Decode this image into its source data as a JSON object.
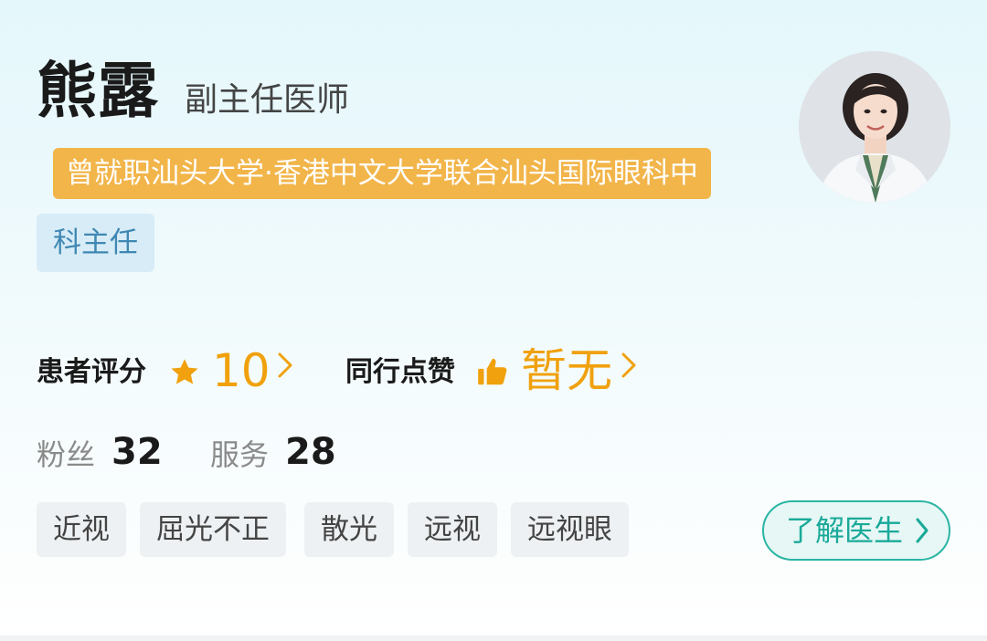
{
  "doctor": {
    "name": "熊露",
    "title": "副主任医师",
    "affiliation_tag": "曾就职汕头大学·香港中文大学联合汕头国际眼科中",
    "department_tag": "科主任",
    "avatar_icon": "doctor-photo"
  },
  "ratings": {
    "patient_label": "患者评分",
    "patient_icon": "star-icon",
    "patient_value": "10",
    "peer_label": "同行点赞",
    "peer_icon": "thumbs-up-icon",
    "peer_value": "暂无",
    "accent_color": "#f0a10d"
  },
  "counts": {
    "fans_label": "粉丝",
    "fans_value": "32",
    "service_label": "服务",
    "service_value": "28"
  },
  "tags": [
    "近视",
    "屈光不正",
    "散光",
    "远视",
    "远视眼"
  ],
  "action": {
    "learn_label": "了解医生",
    "learn_icon": "chevron-right-icon",
    "color": "#1aa999"
  }
}
